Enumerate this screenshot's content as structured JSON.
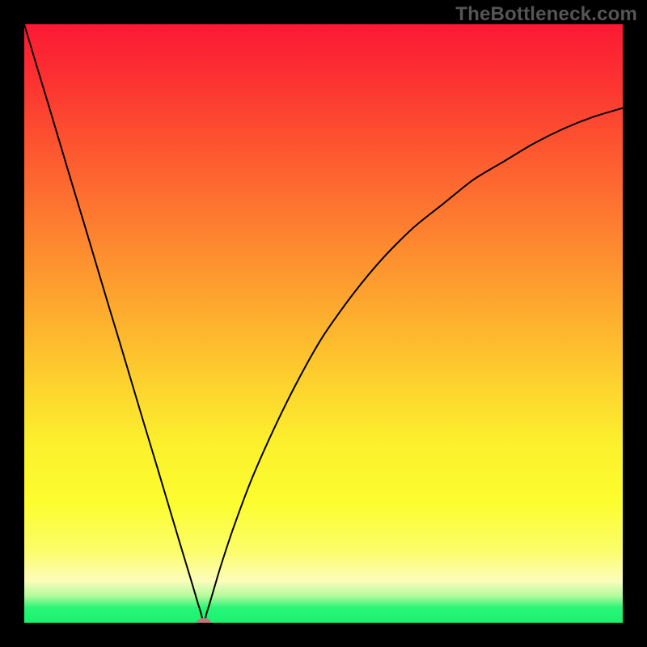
{
  "watermark": "TheBottleneck.com",
  "chart_data": {
    "type": "line",
    "title": "",
    "xlabel": "",
    "ylabel": "",
    "xlim": [
      0,
      100
    ],
    "ylim": [
      0,
      100
    ],
    "grid": false,
    "legend": false,
    "minimum_point": {
      "x": 30,
      "y": 0
    },
    "x": [
      0,
      2,
      4,
      6,
      8,
      10,
      12,
      14,
      16,
      18,
      20,
      22,
      24,
      26,
      27,
      28,
      29,
      29.5,
      30,
      30.5,
      31,
      32,
      33,
      35,
      38,
      42,
      46,
      50,
      55,
      60,
      65,
      70,
      75,
      80,
      85,
      90,
      95,
      100
    ],
    "y": [
      100,
      93.3,
      86.7,
      80,
      73.3,
      66.7,
      60,
      53.3,
      46.7,
      40,
      33.3,
      26.7,
      20,
      13.3,
      10,
      6.7,
      3.3,
      1.7,
      0,
      1.7,
      3.3,
      6.7,
      10,
      16,
      24,
      33,
      41,
      48,
      55,
      61,
      66,
      70,
      74,
      77,
      80,
      82.5,
      84.5,
      86
    ],
    "marker": {
      "x": 30,
      "y": 0,
      "color": "#c17878",
      "rx": 9,
      "ry": 6
    },
    "gradient_stops": [
      {
        "offset": 0.0,
        "color": "#fb1935"
      },
      {
        "offset": 0.1,
        "color": "#fc3431"
      },
      {
        "offset": 0.2,
        "color": "#fd5430"
      },
      {
        "offset": 0.3,
        "color": "#fd7330"
      },
      {
        "offset": 0.4,
        "color": "#fd932f"
      },
      {
        "offset": 0.5,
        "color": "#fdb22e"
      },
      {
        "offset": 0.6,
        "color": "#fdd22e"
      },
      {
        "offset": 0.7,
        "color": "#fcf02d"
      },
      {
        "offset": 0.8,
        "color": "#fcfd2e"
      },
      {
        "offset": 0.88,
        "color": "#fcfd6a"
      },
      {
        "offset": 0.93,
        "color": "#fcfdbb"
      },
      {
        "offset": 0.955,
        "color": "#b4fa9d"
      },
      {
        "offset": 0.975,
        "color": "#2af577"
      },
      {
        "offset": 1.0,
        "color": "#18f36e"
      }
    ]
  }
}
